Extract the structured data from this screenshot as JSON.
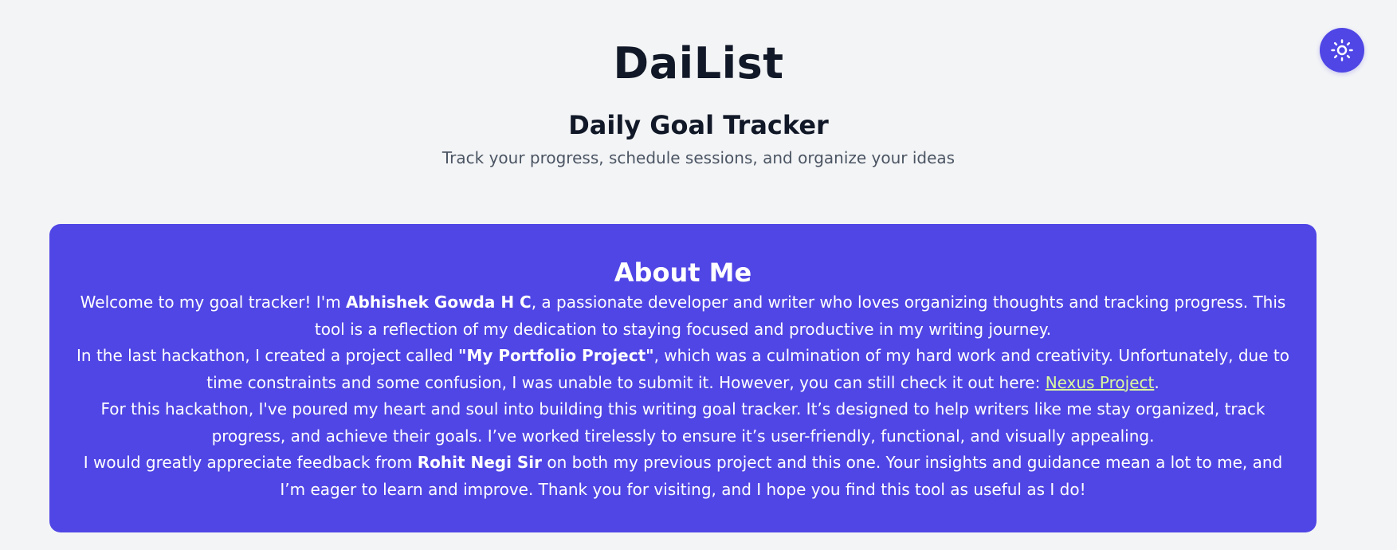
{
  "header": {
    "app_title": "DaiList",
    "page_subtitle": "Daily Goal Tracker",
    "tagline": "Track your progress, schedule sessions, and organize your ideas"
  },
  "theme_toggle": {
    "icon": "sun-icon"
  },
  "about": {
    "title": "About Me",
    "p1_before": "Welcome to my goal tracker! I'm ",
    "p1_name": "Abhishek Gowda H C",
    "p1_after": ", a passionate developer and writer who loves organizing thoughts and tracking progress. This tool is a reflection of my dedication to staying focused and productive in my writing journey.",
    "p2_before": "In the last hackathon, I created a project called ",
    "p2_project": "\"My Portfolio Project\"",
    "p2_middle": ", which was a culmination of my hard work and creativity. Unfortunately, due to time constraints and some confusion, I was unable to submit it. However, you can still check it out here: ",
    "p2_link": "Nexus Project",
    "p2_after": ".",
    "p3": "For this hackathon, I've poured my heart and soul into building this writing goal tracker. It’s designed to help writers like me stay organized, track progress, and achieve their goals. I’ve worked tirelessly to ensure it’s user-friendly, functional, and visually appealing.",
    "p4_before": "I would greatly appreciate feedback from ",
    "p4_name": "Rohit Negi Sir",
    "p4_after": " on both my previous project and this one. Your insights and guidance mean a lot to me, and I’m eager to learn and improve. Thank you for visiting, and I hope you find this tool as useful as I do!"
  },
  "colors": {
    "accent": "#4f46e5",
    "card": "#5046e5",
    "link": "#d9f99d",
    "background": "#f3f4f6"
  }
}
